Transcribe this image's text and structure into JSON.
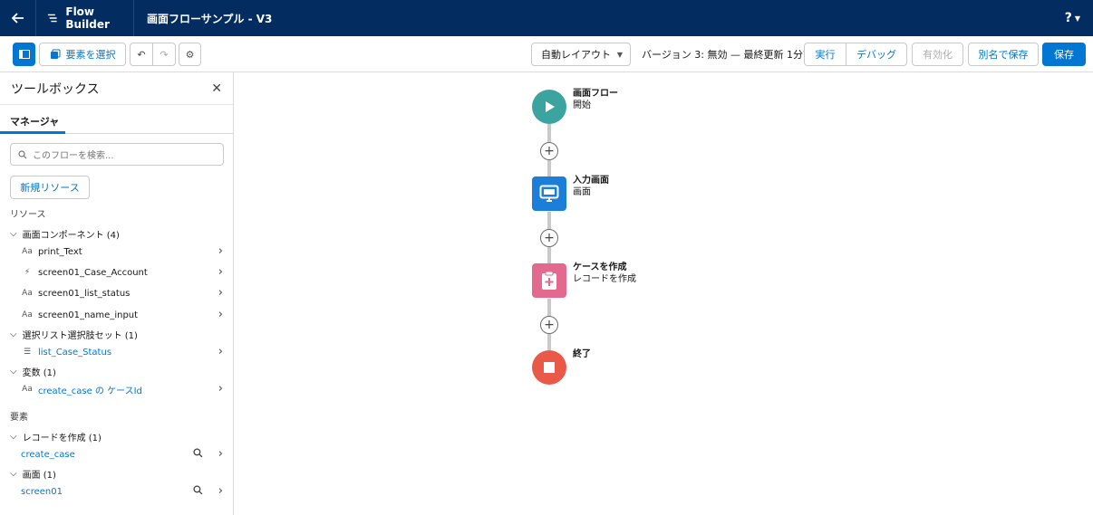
{
  "header": {
    "app_name": "Flow Builder",
    "flow_name": "画面フローサンプル - V3",
    "help": "?"
  },
  "toolbar": {
    "select_elements": "要素を選択",
    "layout": "自動レイアウト",
    "version_status": "バージョン 3: 無効 — 最終更新 1分前",
    "run": "実行",
    "debug": "デバッグ",
    "activate": "有効化",
    "save_as": "別名で保存",
    "save": "保存"
  },
  "sidebar": {
    "title": "ツールボックス",
    "tab": "マネージャ",
    "search_placeholder": "このフローを検索...",
    "new_resource": "新規リソース",
    "resources_label": "リソース",
    "groups": [
      {
        "label": "画面コンポーネント (4)",
        "items": [
          {
            "icon": "Aa",
            "label": "print_Text"
          },
          {
            "icon": "⚡",
            "label": "screen01_Case_Account"
          },
          {
            "icon": "Aa",
            "label": "screen01_list_status"
          },
          {
            "icon": "Aa",
            "label": "screen01_name_input"
          }
        ]
      },
      {
        "label": "選択リスト選択肢セット (1)",
        "items": [
          {
            "icon": "☰",
            "label": "list_Case_Status"
          }
        ]
      },
      {
        "label": "変数 (1)",
        "items": [
          {
            "icon": "Aa",
            "label": "create_case の ケースId"
          }
        ]
      }
    ],
    "elements_label": "要素",
    "element_groups": [
      {
        "label": "レコードを作成 (1)",
        "items": [
          {
            "label": "create_case"
          }
        ]
      },
      {
        "label": "画面 (1)",
        "items": [
          {
            "label": "screen01"
          }
        ]
      }
    ]
  },
  "canvas": {
    "nodes": [
      {
        "title": "画面フロー",
        "subtitle": "開始",
        "color": "#3ba4a0",
        "icon": "play-icon"
      },
      {
        "title": "入力画面",
        "subtitle": "画面",
        "color": "#1b7fd9",
        "icon": "screen-icon"
      },
      {
        "title": "ケースを作成",
        "subtitle": "レコードを作成",
        "color": "#e3698f",
        "icon": "create-record-icon"
      },
      {
        "title": "終了",
        "subtitle": "",
        "color": "#ea5848",
        "icon": "stop-icon"
      }
    ]
  }
}
